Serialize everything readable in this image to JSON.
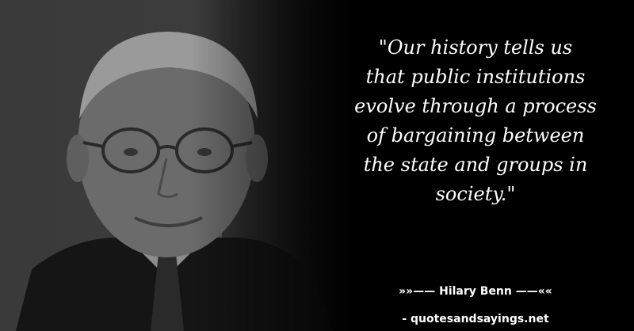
{
  "quote": {
    "text": "\"Our history tells us\nthat public institutions\nevolve through a process\nof bargaining between\nthe state and groups in\nsociety.\""
  },
  "attribution": {
    "author_line": "»»—— Hilary Benn ——««",
    "site_line": "- quotesandsayings.net"
  }
}
